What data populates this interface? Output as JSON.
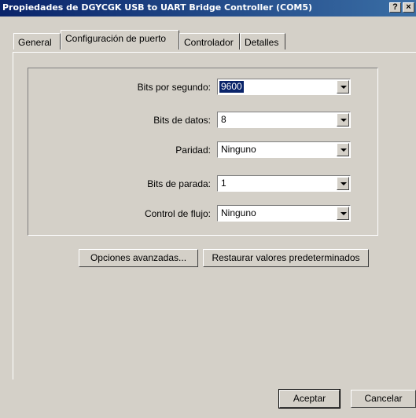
{
  "window": {
    "title": "Propiedades de DGYCGK USB to UART Bridge Controller (COM5)",
    "help_button": "?",
    "close_button": "×"
  },
  "tabs": [
    {
      "label": "General"
    },
    {
      "label": "Configuración de puerto"
    },
    {
      "label": "Controlador"
    },
    {
      "label": "Detalles"
    }
  ],
  "settings": {
    "bits_per_second": {
      "label": "Bits por segundo:",
      "value": "9600"
    },
    "data_bits": {
      "label": "Bits de datos:",
      "value": "8"
    },
    "parity": {
      "label": "Paridad:",
      "value": "Ninguno"
    },
    "stop_bits": {
      "label": "Bits de parada:",
      "value": "1"
    },
    "flow_control": {
      "label": "Control de flujo:",
      "value": "Ninguno"
    }
  },
  "buttons": {
    "advanced": "Opciones avanzadas...",
    "restore": "Restaurar valores predeterminados",
    "ok": "Aceptar",
    "cancel": "Cancelar"
  }
}
